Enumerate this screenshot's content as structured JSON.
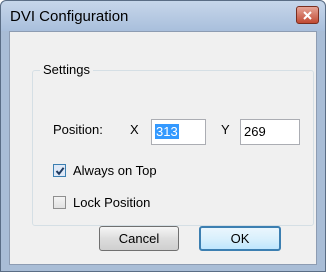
{
  "window": {
    "title": "DVI Configuration"
  },
  "settings": {
    "group_label": "Settings",
    "position_label": "Position:",
    "x_label": "X",
    "x_value": "313",
    "y_label": "Y",
    "y_value": "269",
    "always_on_top_label": "Always on Top",
    "always_on_top_checked": true,
    "lock_position_label": "Lock Position",
    "lock_position_checked": false
  },
  "buttons": {
    "cancel": "Cancel",
    "ok": "OK"
  },
  "colors": {
    "accent": "#3c7fb1",
    "close": "#c14a33",
    "selection": "#3399ff"
  }
}
